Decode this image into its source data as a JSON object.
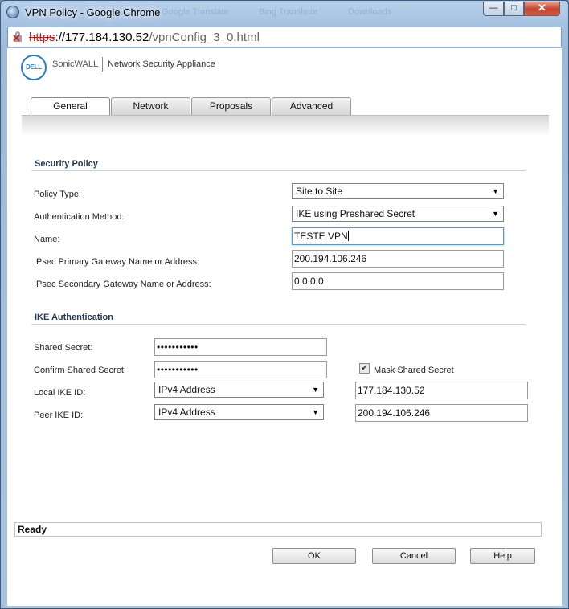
{
  "window": {
    "title": "VPN Policy - Google Chrome",
    "background_tabs": [
      "Google Translate",
      "Bing Translator",
      "Downloads"
    ],
    "controls": {
      "minimize": "—",
      "maximize": "□",
      "close": "✕"
    }
  },
  "address_bar": {
    "scheme": "https",
    "host": "://177.184.130.52",
    "path": "/vpnConfig_3_0.html",
    "icon": "insecure-lock-icon"
  },
  "header": {
    "logo_text": "DELL",
    "brand": "SonicWALL",
    "product": "Network Security Appliance"
  },
  "tabs": [
    {
      "label": "General",
      "active": true
    },
    {
      "label": "Network",
      "active": false
    },
    {
      "label": "Proposals",
      "active": false
    },
    {
      "label": "Advanced",
      "active": false
    }
  ],
  "security_policy": {
    "title": "Security Policy",
    "policy_type_label": "Policy Type:",
    "policy_type_value": "Site to Site",
    "auth_method_label": "Authentication Method:",
    "auth_method_value": "IKE using Preshared Secret",
    "name_label": "Name:",
    "name_value": "TESTE VPN",
    "primary_gw_label": "IPsec Primary Gateway Name or Address:",
    "primary_gw_value": "200.194.106.246",
    "secondary_gw_label": "IPsec Secondary Gateway Name or Address:",
    "secondary_gw_value": "0.0.0.0"
  },
  "ike_auth": {
    "title": "IKE Authentication",
    "shared_secret_label": "Shared Secret:",
    "shared_secret_value": "•••••••••••",
    "confirm_secret_label": "Confirm Shared Secret:",
    "confirm_secret_value": "•••••••••••",
    "mask_label": "Mask Shared Secret",
    "mask_checked": true,
    "local_id_label": "Local IKE ID:",
    "local_id_type": "IPv4 Address",
    "local_id_value": "177.184.130.52",
    "peer_id_label": "Peer IKE ID:",
    "peer_id_type": "IPv4 Address",
    "peer_id_value": "200.194.106.246"
  },
  "status": "Ready",
  "buttons": {
    "ok": "OK",
    "cancel": "Cancel",
    "help": "Help"
  },
  "colors": {
    "accent": "#2a7dc1",
    "section_title": "#243a5a",
    "insecure": "#c01c1c"
  }
}
